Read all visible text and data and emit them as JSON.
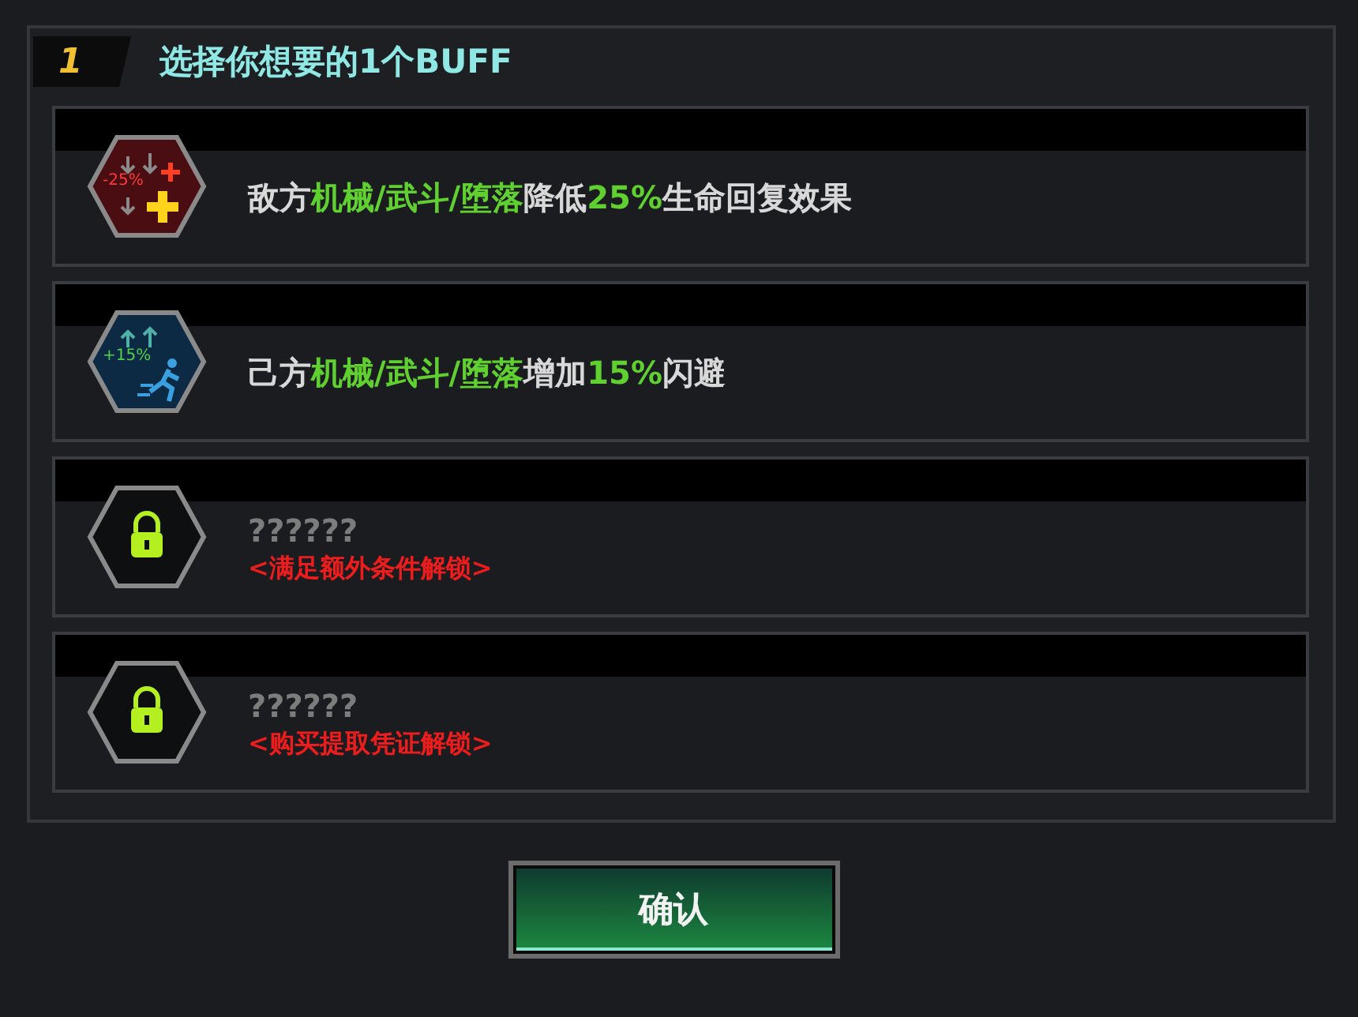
{
  "header": {
    "step": "1",
    "title": "选择你想要的1个BUFF"
  },
  "options": [
    {
      "kind": "debuff",
      "icon_label": "-25%",
      "segments": [
        {
          "text": "敌方",
          "highlight": false
        },
        {
          "text": "机械/武斗/堕落",
          "highlight": true
        },
        {
          "text": "降低",
          "highlight": false
        },
        {
          "text": "25%",
          "highlight": true
        },
        {
          "text": "生命回复效果",
          "highlight": false
        }
      ]
    },
    {
      "kind": "buff",
      "icon_label": "+15%",
      "segments": [
        {
          "text": "己方",
          "highlight": false
        },
        {
          "text": "机械/武斗/堕落",
          "highlight": true
        },
        {
          "text": "增加",
          "highlight": false
        },
        {
          "text": "15%",
          "highlight": true
        },
        {
          "text": "闪避",
          "highlight": false
        }
      ]
    },
    {
      "kind": "locked",
      "name": "??????",
      "condition": "<满足额外条件解锁>"
    },
    {
      "kind": "locked",
      "name": "??????",
      "condition": "<购买提取凭证解锁>"
    }
  ],
  "confirm_button": "确认"
}
